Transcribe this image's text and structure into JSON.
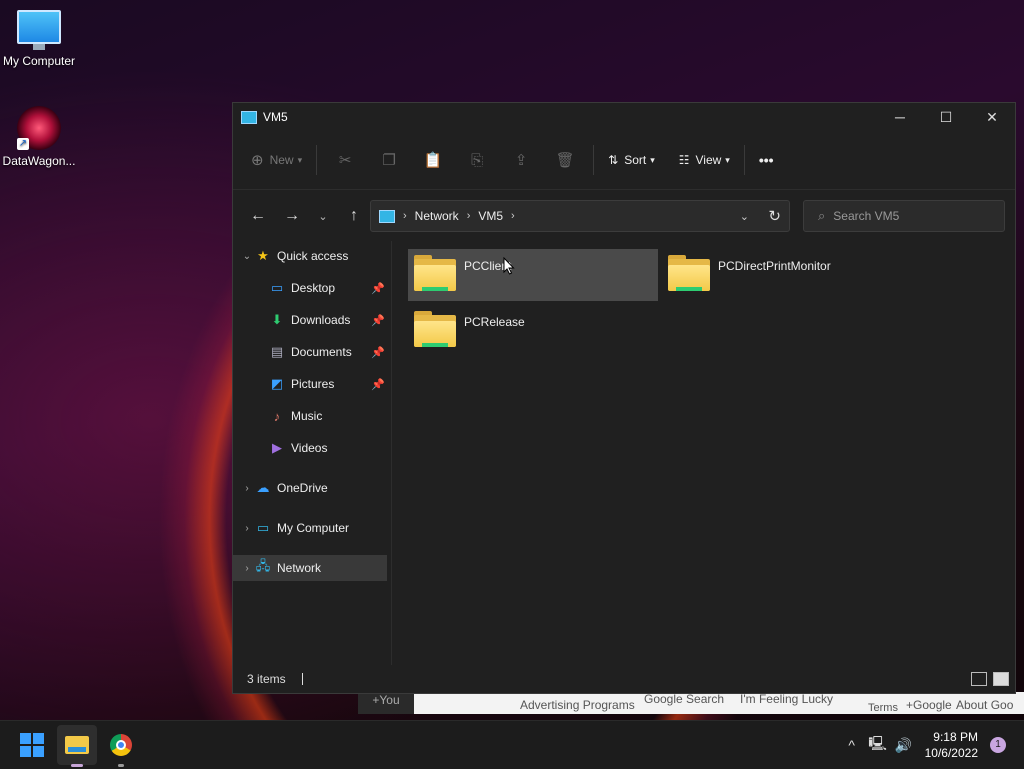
{
  "desktop": {
    "icons": [
      {
        "label": "My Computer",
        "icon": "monitor-icon"
      },
      {
        "label": "DataWagon...",
        "icon": "datawagon-icon"
      }
    ]
  },
  "window": {
    "title": "VM5",
    "toolbar": {
      "new_label": "New",
      "sort_label": "Sort",
      "view_label": "View",
      "more_label": "•••"
    },
    "address": {
      "crumbs": [
        "Network",
        "VM5"
      ]
    },
    "search": {
      "placeholder": "Search VM5"
    },
    "nav": {
      "quick_access": "Quick access",
      "items": [
        {
          "label": "Desktop",
          "pinned": true
        },
        {
          "label": "Downloads",
          "pinned": true
        },
        {
          "label": "Documents",
          "pinned": true
        },
        {
          "label": "Pictures",
          "pinned": true
        },
        {
          "label": "Music",
          "pinned": false
        },
        {
          "label": "Videos",
          "pinned": false
        }
      ],
      "onedrive": "OneDrive",
      "my_computer": "My Computer",
      "network": "Network"
    },
    "folders": [
      {
        "name": "PCClient"
      },
      {
        "name": "PCDirectPrintMonitor"
      },
      {
        "name": "PCRelease"
      }
    ],
    "status": {
      "items_count": "3 items"
    }
  },
  "background_page": {
    "you": "+You",
    "advertising": "Advertising Programs",
    "google_search": "Google Search",
    "feeling_lucky": "I'm Feeling Lucky",
    "plus_google": "+Google",
    "about": "About Goo",
    "terms": "Terms"
  },
  "taskbar": {
    "time": "9:18 PM",
    "date": "10/6/2022",
    "notification_count": "1"
  },
  "colors": {
    "window_bg": "#202020",
    "accent": "#33b5e5",
    "folder": "#f3c948"
  }
}
